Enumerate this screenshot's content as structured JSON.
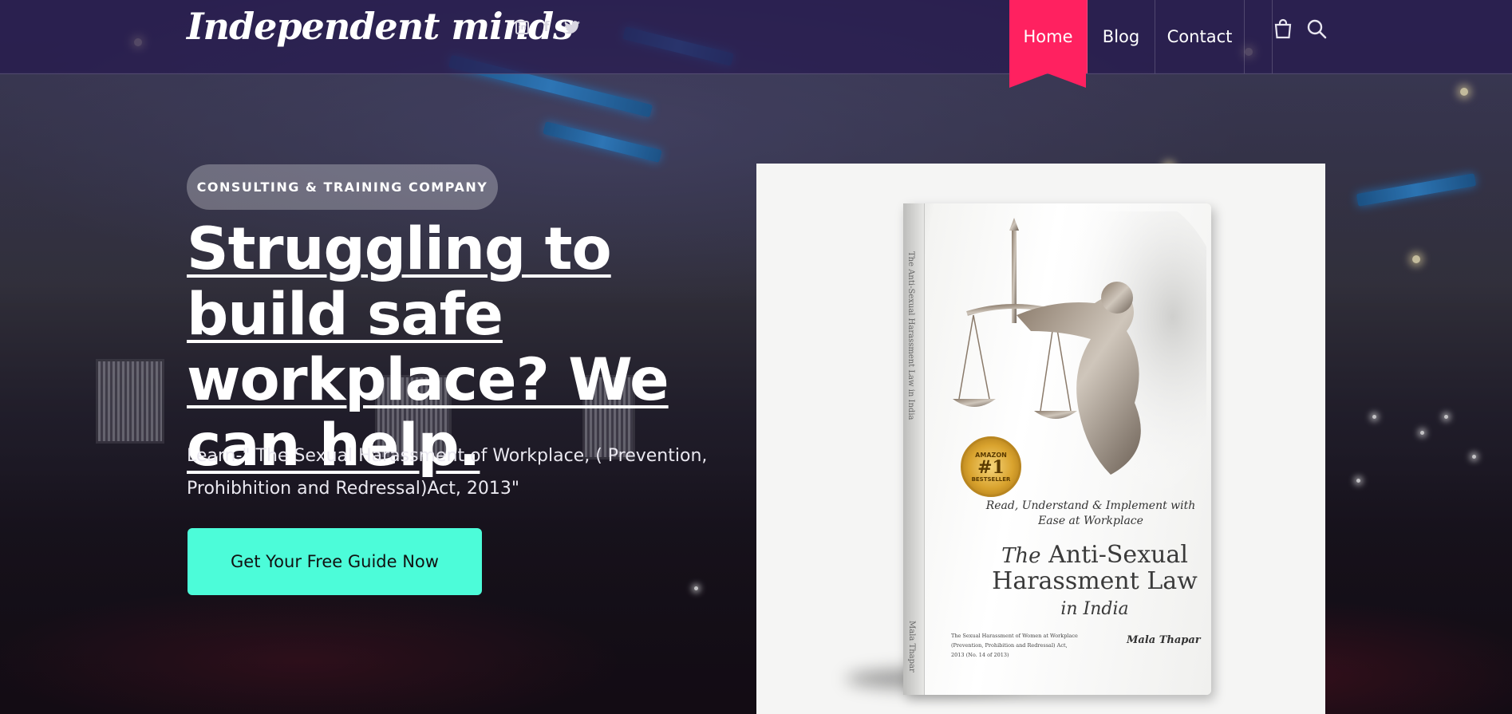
{
  "header": {
    "logo": "Independent minds",
    "nav": {
      "home": "Home",
      "blog": "Blog",
      "contact": "Contact"
    },
    "icons": [
      "linkedin-icon",
      "facebook-icon",
      "twitter-icon",
      "shopping-bag-icon",
      "search-icon"
    ]
  },
  "hero": {
    "badge": "CONSULTING & TRAINING COMPANY",
    "headline": "Struggling to build safe workplace? We can help.",
    "subtext": "Learn-\" The Sexual Harassment of Workplace, ( Prevention, Prohibhition and Redressal)Act, 2013\"",
    "cta": "Get Your Free Guide Now"
  },
  "book": {
    "spine_title": "The Anti-Sexual Harassment Law in India",
    "spine_author": "Mala Thapar",
    "seal_top": "AMAZON",
    "seal_number": "#1",
    "seal_bottom": "BESTSELLER",
    "tagline": "Read, Understand & Implement with Ease at Workplace",
    "title_the": "The",
    "title_main": "Anti-Sexual Harassment Law",
    "title_tail": "in India",
    "fine_print": "The Sexual Harassment of Women at Workplace (Prevention, Prohibition and Redressal) Act, 2013 (No. 14 of 2013)",
    "author": "Mala Thapar"
  },
  "colors": {
    "nav_active": "#ff2160",
    "cta": "#4cfcd9"
  }
}
